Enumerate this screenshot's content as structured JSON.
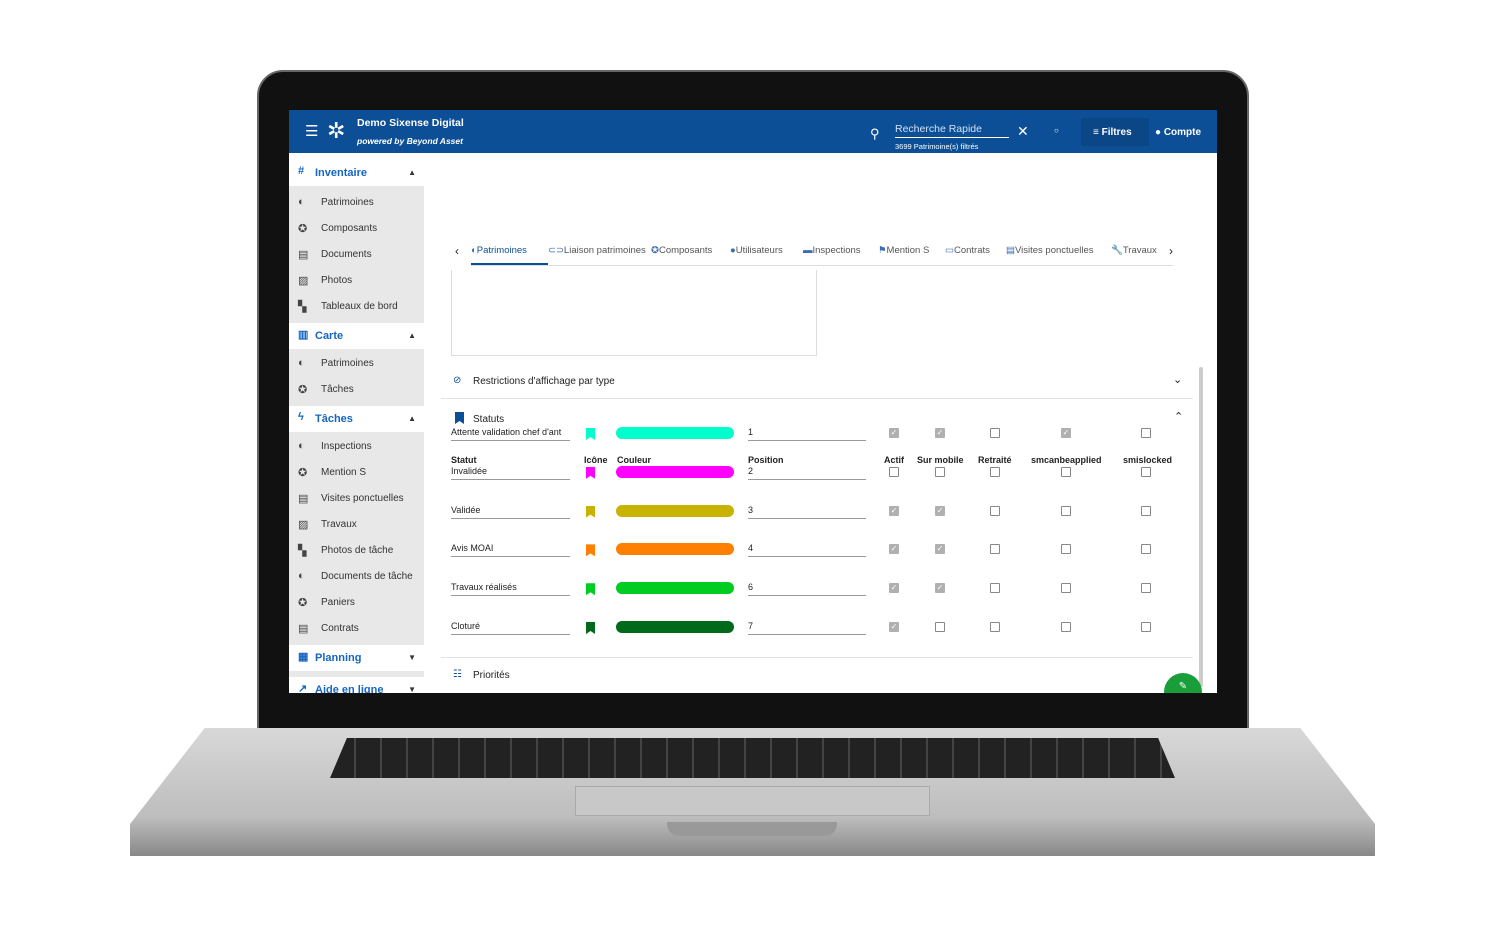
{
  "header": {
    "title": "Demo Sixense Digital",
    "subtitle": "powered by Beyond Asset",
    "search_placeholder": "Recherche Rapide",
    "search_hint": "3699 Patrimoine(s) filtrés",
    "filters": "Filtres",
    "account": "Compte"
  },
  "sidebar": {
    "sections": [
      {
        "label": "Inventaire",
        "icon": "hash-icon",
        "items": [
          "Patrimoines",
          "Composants",
          "Documents",
          "Photos",
          "Tableaux de bord"
        ]
      },
      {
        "label": "Carte",
        "icon": "map-icon",
        "items": [
          "Patrimoines",
          "Tâches"
        ]
      },
      {
        "label": "Tâches",
        "icon": "bolt-icon",
        "items": [
          "Inspections",
          "Mention S",
          "Visites ponctuelles",
          "Travaux",
          "Photos de tâche",
          "Documents de tâche",
          "Paniers",
          "Contrats"
        ]
      },
      {
        "label": "Planning",
        "icon": "calendar-icon",
        "items": []
      },
      {
        "label": "Aide en ligne",
        "icon": "external-link-icon",
        "items": []
      }
    ]
  },
  "tabs": [
    "Patrimoines",
    "Liaison patrimoines",
    "Composants",
    "Utilisateurs",
    "Inspections",
    "Mention S",
    "Contrats",
    "Visites ponctuelles",
    "Travaux"
  ],
  "active_tab": "Patrimoines",
  "panels": {
    "restrictions": "Restrictions d'affichage par type",
    "statuts": "Statuts",
    "priorites": "Priorités"
  },
  "table": {
    "headers": [
      "Statut",
      "Icône",
      "Couleur",
      "Position",
      "Actif",
      "Sur mobile",
      "Retraité",
      "smcanbeapplied",
      "smislocked"
    ],
    "rows": [
      {
        "statut": "Attente validation chef d'ant",
        "color": "#00ffcc",
        "position": "1",
        "checks": [
          true,
          true,
          false,
          true,
          false
        ]
      },
      {
        "statut": "Invalidée",
        "color": "#ff00ff",
        "position": "2",
        "checks": [
          false,
          false,
          false,
          false,
          false
        ]
      },
      {
        "statut": "Validée",
        "color": "#c8b400",
        "position": "3",
        "checks": [
          true,
          true,
          false,
          false,
          false
        ]
      },
      {
        "statut": "Avis MOAI",
        "color": "#ff8000",
        "position": "4",
        "checks": [
          true,
          true,
          false,
          false,
          false
        ]
      },
      {
        "statut": "Travaux réalisés",
        "color": "#00cc22",
        "position": "6",
        "checks": [
          true,
          true,
          false,
          false,
          false
        ]
      },
      {
        "statut": "Cloturé",
        "color": "#006a1a",
        "position": "7",
        "checks": [
          true,
          false,
          false,
          false,
          false
        ]
      }
    ]
  },
  "colors": {
    "primary": "#0d4f96",
    "accent": "#1565c0",
    "fab": "#1a9e3a"
  }
}
